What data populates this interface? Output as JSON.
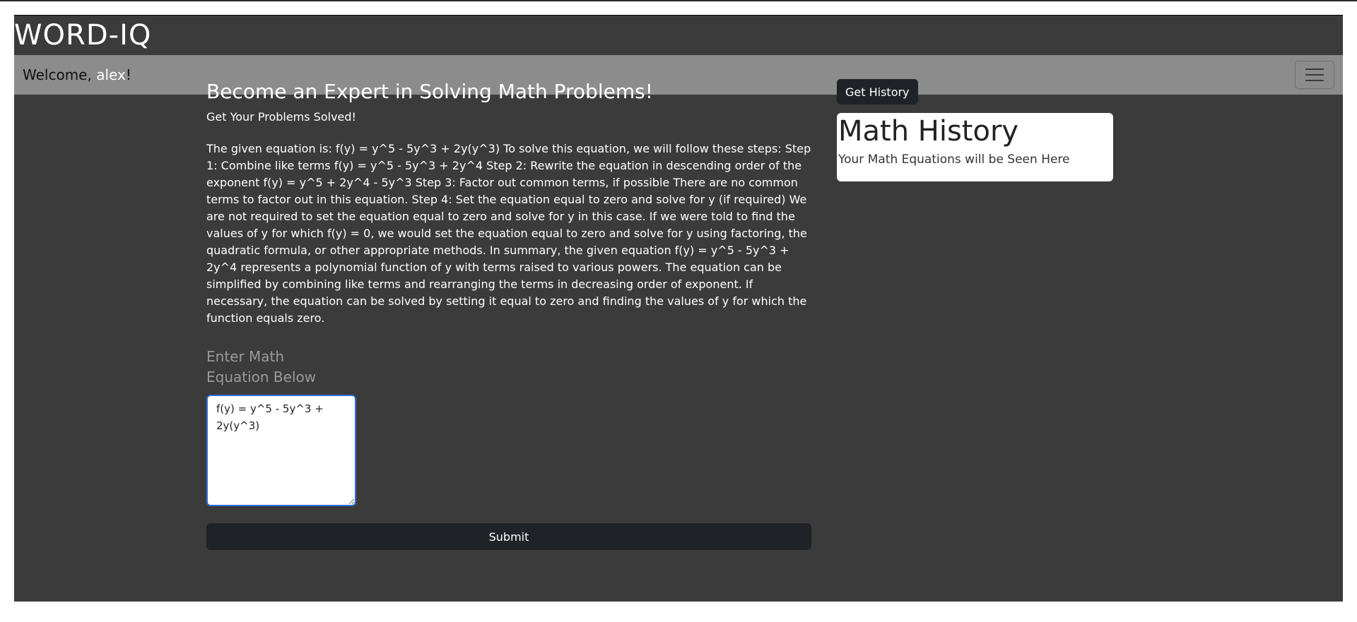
{
  "brand": "WORD-IQ",
  "nav": {
    "welcome_prefix": "Welcome, ",
    "username": "alex",
    "welcome_suffix": "!"
  },
  "main": {
    "headline": "Become an Expert in Solving Math Problems!",
    "subline": "Get Your Problems Solved!",
    "answer": "The given equation is: f(y) = y^5 - 5y^3 + 2y(y^3) To solve this equation, we will follow these steps: Step 1: Combine like terms f(y) = y^5 - 5y^3 + 2y^4 Step 2: Rewrite the equation in descending order of the exponent f(y) = y^5 + 2y^4 - 5y^3 Step 3: Factor out common terms, if possible There are no common terms to factor out in this equation. Step 4: Set the equation equal to zero and solve for y (if required) We are not required to set the equation equal to zero and solve for y in this case. If we were told to find the values of y for which f(y) = 0, we would set the equation equal to zero and solve for y using factoring, the quadratic formula, or other appropriate methods. In summary, the given equation f(y) = y^5 - 5y^3 + 2y^4 represents a polynomial function of y with terms raised to various powers. The equation can be simplified by combining like terms and rearranging the terms in decreasing order of exponent. If necessary, the equation can be solved by setting it equal to zero and finding the values of y for which the function equals zero.",
    "field_label": "Enter Math Equation Below",
    "equation_value": "f(y) = y^5 - 5y^3 + 2y(y^3)",
    "submit_label": "Submit"
  },
  "side": {
    "history_button": "Get History",
    "history_title": "Math History",
    "history_text": "Your Math Equations will be Seen Here"
  }
}
